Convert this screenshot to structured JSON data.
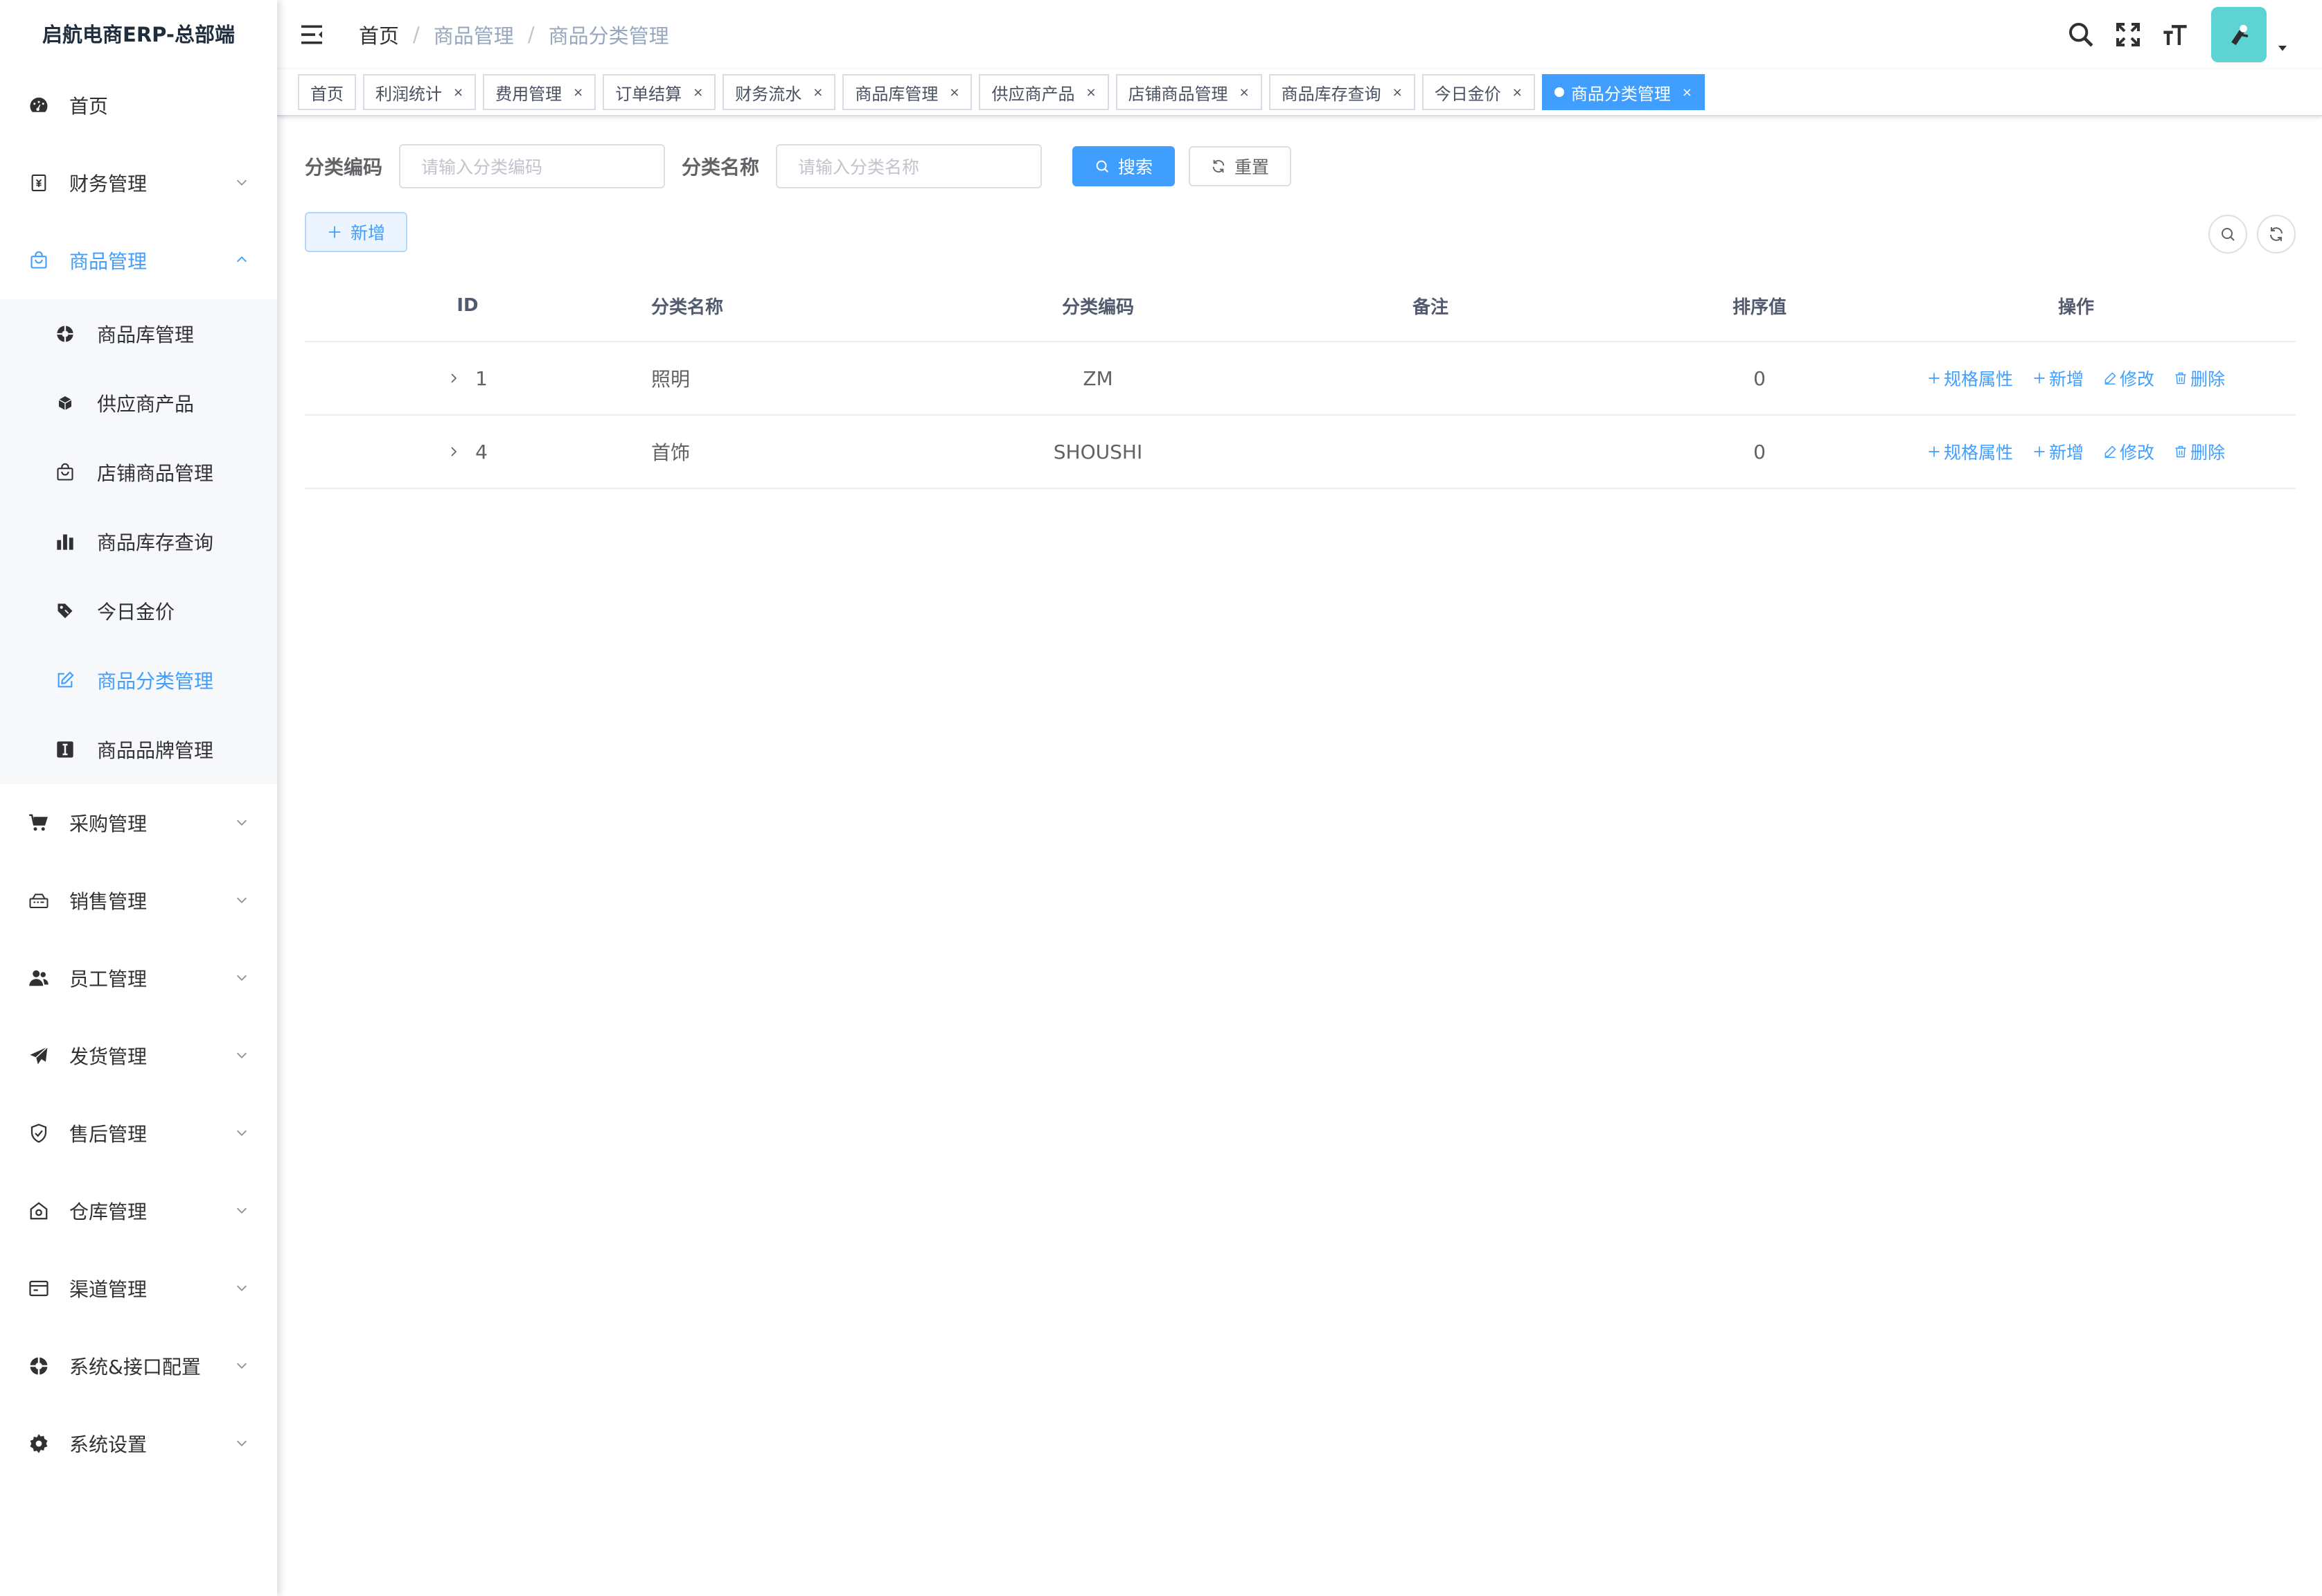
{
  "app": {
    "title": "启航电商ERP-总部端"
  },
  "sidebar": {
    "items": [
      {
        "label": "首页",
        "icon": "dashboard-icon"
      },
      {
        "label": "财务管理",
        "icon": "finance-icon"
      },
      {
        "label": "商品管理",
        "icon": "shopping-bag-icon"
      },
      {
        "label": "采购管理",
        "icon": "cart-icon"
      },
      {
        "label": "销售管理",
        "icon": "sales-icon"
      },
      {
        "label": "员工管理",
        "icon": "people-icon"
      },
      {
        "label": "发货管理",
        "icon": "send-icon"
      },
      {
        "label": "售后管理",
        "icon": "shield-icon"
      },
      {
        "label": "仓库管理",
        "icon": "warehouse-icon"
      },
      {
        "label": "渠道管理",
        "icon": "channel-icon"
      },
      {
        "label": "系统&接口配置",
        "icon": "config-icon"
      },
      {
        "label": "系统设置",
        "icon": "gear-icon"
      }
    ],
    "submenu": [
      {
        "label": "商品库管理",
        "icon": "aperture-icon"
      },
      {
        "label": "供应商产品",
        "icon": "box-icon"
      },
      {
        "label": "店铺商品管理",
        "icon": "store-bag-icon"
      },
      {
        "label": "商品库存查询",
        "icon": "bar-chart-icon"
      },
      {
        "label": "今日金价",
        "icon": "price-tag-icon"
      },
      {
        "label": "商品分类管理",
        "icon": "edit-icon"
      },
      {
        "label": "商品品牌管理",
        "icon": "brand-icon"
      }
    ]
  },
  "header": {
    "breadcrumb": [
      "首页",
      "商品管理",
      "商品分类管理"
    ],
    "breadcrumb_sep": "/"
  },
  "tags": [
    {
      "label": "首页"
    },
    {
      "label": "利润统计"
    },
    {
      "label": "费用管理"
    },
    {
      "label": "订单结算"
    },
    {
      "label": "财务流水"
    },
    {
      "label": "商品库管理"
    },
    {
      "label": "供应商产品"
    },
    {
      "label": "店铺商品管理"
    },
    {
      "label": "商品库存查询"
    },
    {
      "label": "今日金价"
    },
    {
      "label": "商品分类管理"
    }
  ],
  "tag_close": "×",
  "search": {
    "code_label": "分类编码",
    "code_placeholder": "请输入分类编码",
    "name_label": "分类名称",
    "name_placeholder": "请输入分类名称",
    "search_button": "搜索",
    "reset_button": "重置"
  },
  "toolbar": {
    "add_button": "新增"
  },
  "table": {
    "columns": [
      "ID",
      "分类名称",
      "分类编码",
      "备注",
      "排序值",
      "操作"
    ],
    "rows": [
      {
        "id": "1",
        "name": "照明",
        "code": "ZM",
        "remark": "",
        "sort": "0"
      },
      {
        "id": "4",
        "name": "首饰",
        "code": "SHOUSHI",
        "remark": "",
        "sort": "0"
      }
    ],
    "actions": [
      "规格属性",
      "新增",
      "修改",
      "删除"
    ]
  },
  "colors": {
    "primary": "#409eff",
    "avatar_bg": "#5ed3d3",
    "text": "#303133"
  }
}
